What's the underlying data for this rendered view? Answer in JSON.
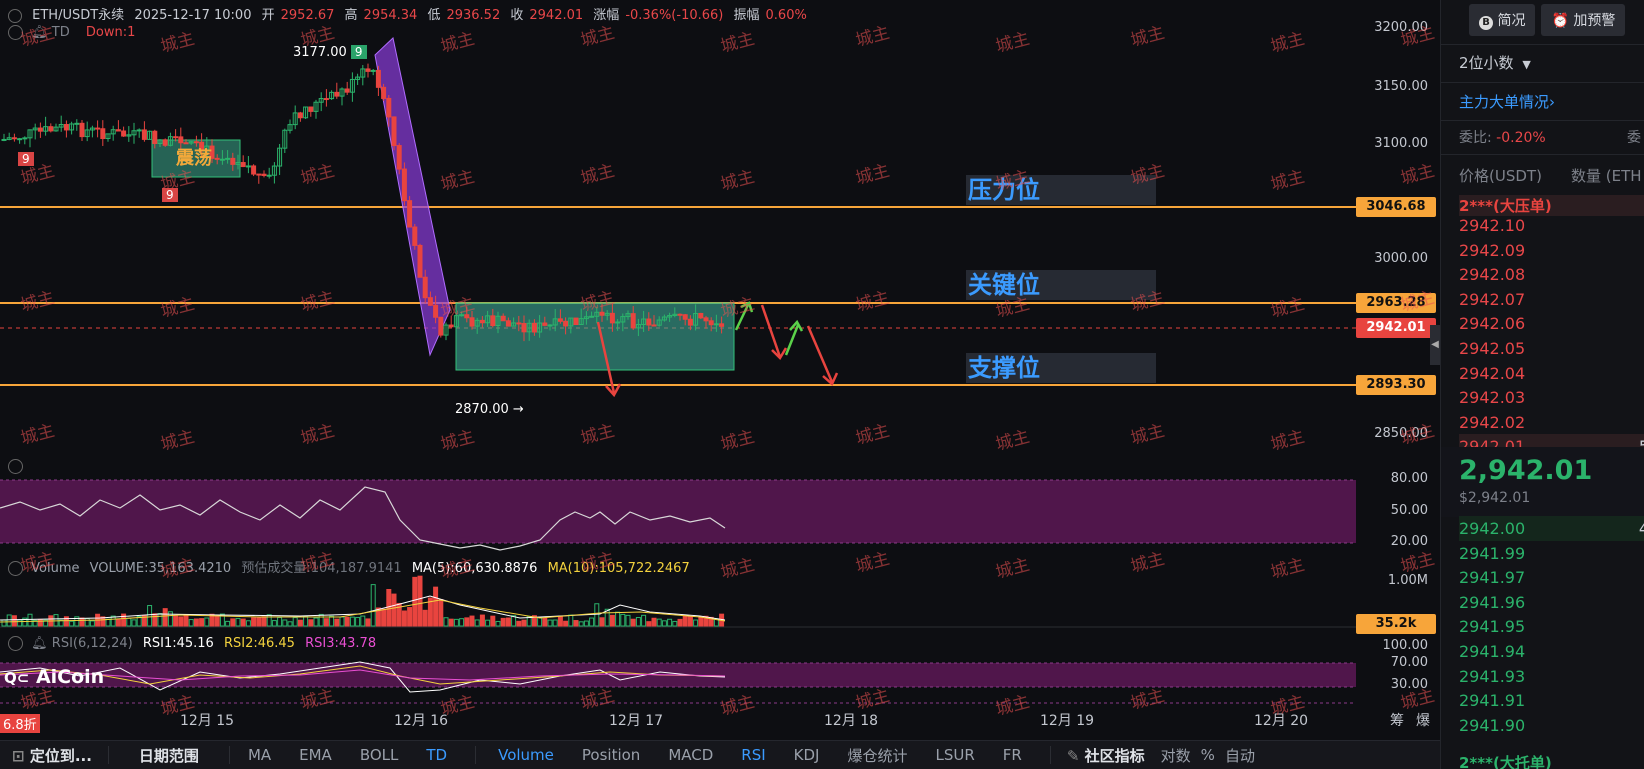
{
  "header": {
    "symbol": "ETH/USDT永续",
    "datetime": "2025-12-17 10:00",
    "open_label": "开",
    "open": "2952.67",
    "high_label": "高",
    "high": "2954.34",
    "low_label": "低",
    "low": "2936.52",
    "close_label": "收",
    "close": "2942.01",
    "change_label": "涨幅",
    "change": "-0.36%(-10.66)",
    "amplitude_label": "振幅",
    "amplitude": "0.60%"
  },
  "td_indicator": {
    "name": "TD",
    "value": "Down:1"
  },
  "price_axis": {
    "ticks": [
      "3200.00",
      "3150.00",
      "3100.00",
      "3000.00",
      "2850.00"
    ],
    "levels": [
      {
        "value": "3046.68",
        "color": "#f7a53a"
      },
      {
        "value": "2963.28",
        "color": "#f7a53a"
      },
      {
        "value": "2942.01",
        "color": "#e8443f"
      },
      {
        "value": "2893.30",
        "color": "#f7a53a"
      }
    ]
  },
  "annotations": {
    "high_label": "3177.00",
    "td_mark_top": "9",
    "td_mark_left_1": "9",
    "td_mark_left_2": "9",
    "low_label": "2870.00",
    "low_arrow": "→",
    "consolidation_label": "震荡",
    "resistance_label": "压力位",
    "key_label": "关键位",
    "support_label": "支撑位"
  },
  "rsi_panel": {
    "ticks": [
      "80.00",
      "50.00",
      "20.00"
    ]
  },
  "volume_panel": {
    "name": "Volume",
    "volume": "VOLUME:35,163.4210",
    "estimate": "预估成交量:104,187.9141",
    "ma5": "MA(5):60,630.8876",
    "ma10": "MA(10):105,722.2467",
    "tick": "1.00M",
    "current_tag": "35.2k"
  },
  "rsi_lower_panel": {
    "name": "RSI(6,12,24)",
    "rsi1": "RSI1:45.16",
    "rsi2": "RSI2:46.45",
    "rsi3": "RSI3:43.78",
    "ticks": [
      "100.00",
      "70.00",
      "30.00"
    ]
  },
  "logo": "AiCoin",
  "discount_badge": "6.8折",
  "time_axis": [
    "12月 15",
    "12月 16",
    "12月 17",
    "12月 18",
    "12月 19",
    "12月 20"
  ],
  "time_axis_right": [
    "筹",
    "爆"
  ],
  "watermark_text": "城主",
  "toolbar": {
    "locate": "定位到...",
    "date_range": "日期范围",
    "main_indicators": [
      "MA",
      "EMA",
      "BOLL",
      "TD"
    ],
    "sub_indicators": [
      "Volume",
      "Position",
      "MACD",
      "RSI",
      "KDJ",
      "爆仓统计",
      "LSUR",
      "FR"
    ],
    "community": "社区指标",
    "log": "对数",
    "percent": "%",
    "auto": "自动"
  },
  "right_panel": {
    "brief_button": "简况",
    "alert_button": "加预警",
    "decimal_select": "2位小数",
    "main_orders_link": "主力大单情况",
    "ratio_label": "委比:",
    "ratio_value": "-0.20%",
    "ratio_label2": "委",
    "col_price": "价格(USDT)",
    "col_qty": "数量 (ETH",
    "big_ask_label": "2***(大压单)",
    "asks": [
      "2942.10",
      "2942.09",
      "2942.08",
      "2942.07",
      "2942.06",
      "2942.05",
      "2942.04",
      "2942.03",
      "2942.02",
      "2942.01"
    ],
    "ask_last_qty": "5",
    "last_price": "2,942.01",
    "last_price_usd": "$2,942.01",
    "bids": [
      "2942.00",
      "2941.99",
      "2941.97",
      "2941.96",
      "2941.95",
      "2941.94",
      "2941.93",
      "2941.91",
      "2941.90"
    ],
    "bid_first_qty": "4",
    "big_bid_label": "2***(大托单)"
  }
}
